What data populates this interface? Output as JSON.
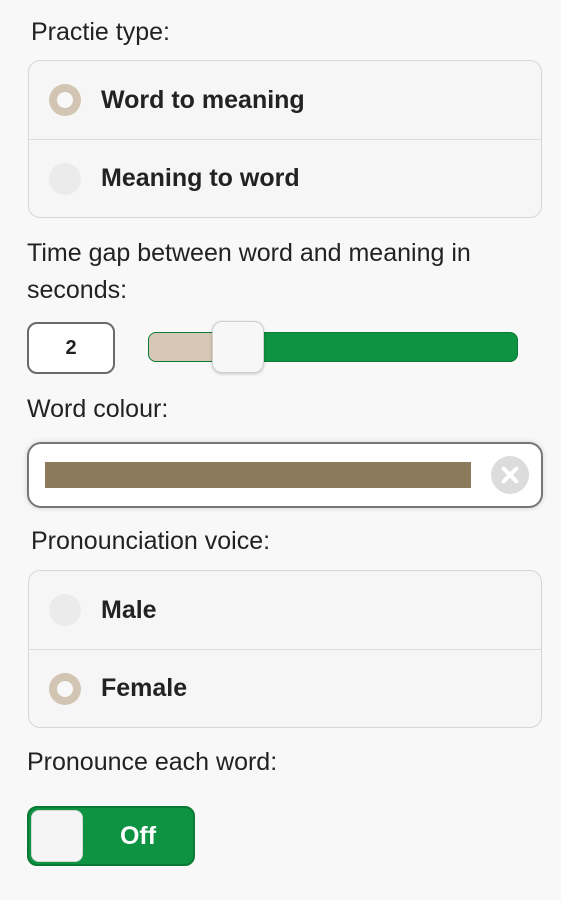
{
  "practice": {
    "label": "Practie type:",
    "options": [
      {
        "label": "Word to meaning",
        "selected": true
      },
      {
        "label": "Meaning to word",
        "selected": false
      }
    ]
  },
  "time_gap": {
    "label": "Time gap between word and meaning in seconds:",
    "value": "2",
    "slider_fraction": 0.18
  },
  "word_colour": {
    "label": "Word colour:",
    "color": "#8b7b5c"
  },
  "voice": {
    "label": "Pronounciation voice:",
    "options": [
      {
        "label": "Male",
        "selected": false
      },
      {
        "label": "Female",
        "selected": true
      }
    ]
  },
  "pronounce": {
    "label": "Pronounce each word:",
    "state": "Off"
  },
  "colors": {
    "accent_green": "#0d9341",
    "radio_selected": "#d3c5b3"
  }
}
